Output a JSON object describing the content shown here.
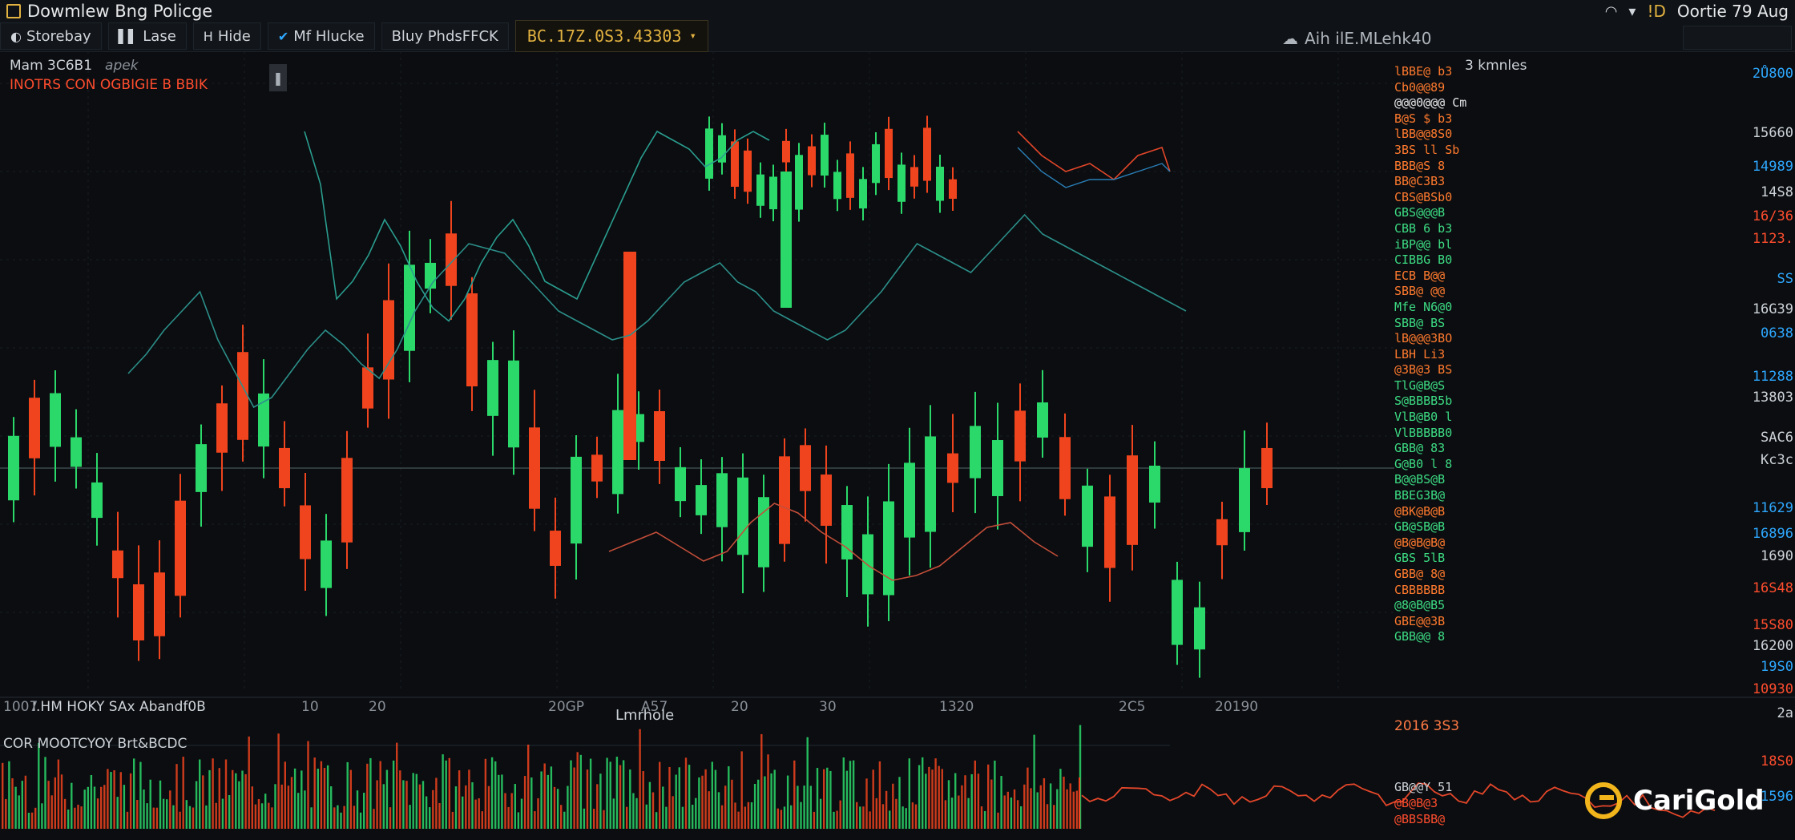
{
  "window": {
    "title": "Dowmlew Bng Policge",
    "clock": "Oortie 79 Aug",
    "clock_prefix": "!D"
  },
  "toolbar": {
    "buttons": [
      {
        "label": "Storebay",
        "icon": "compass-icon"
      },
      {
        "label": "Lase",
        "icon": "bar-icon"
      },
      {
        "label": "Hide",
        "icon": "h-icon"
      },
      {
        "label": "Mf Hlucke",
        "icon": "check-icon"
      },
      {
        "label": "Bluy PhdsFFCK",
        "icon": "none"
      }
    ],
    "price_field": "BC.17Z.0S3.43303",
    "center_label": "Aih ilE.MLehk40"
  },
  "legend": {
    "symbol": "Mam 3C6B1",
    "symbol2": "apek",
    "subtitle": "INOTRS CON OGBIGIE B BBIK"
  },
  "ladder": {
    "heading": "3 kmnles",
    "rows": [
      {
        "text": "lBBE@ b3",
        "color": "#ff7a2e"
      },
      {
        "text": "Cb0@@89",
        "color": "#ff7a2e"
      },
      {
        "text": "@@@0@@@ Cm",
        "color": "#e6e8ea"
      },
      {
        "text": "B@S $ b3",
        "color": "#ff7a2e"
      },
      {
        "text": "lBB@@8S0",
        "color": "#ff7a2e"
      },
      {
        "text": "3BS ll Sb",
        "color": "#ff7a2e"
      },
      {
        "text": "BBB@S 8",
        "color": "#ff7a2e"
      },
      {
        "text": "BB@C3B3",
        "color": "#ff7a2e"
      },
      {
        "text": "CBS@BSb0",
        "color": "#ff7a2e"
      },
      {
        "text": "GBS@@@B",
        "color": "#3ddc84"
      },
      {
        "text": "CBB 6 b3",
        "color": "#3ddc84"
      },
      {
        "text": "iBP@@ bl",
        "color": "#3ddc84"
      },
      {
        "text": "CIBBG B0",
        "color": "#3ddc84"
      },
      {
        "text": "ECB B@@",
        "color": "#ff7a2e"
      },
      {
        "text": "SBB@ @@",
        "color": "#ff7a2e"
      },
      {
        "text": "Mfe N6@0",
        "color": "#3ddc84"
      },
      {
        "text": "SBB@ BS",
        "color": "#3ddc84"
      },
      {
        "text": "lB@@@3BO",
        "color": "#ff7a2e"
      },
      {
        "text": "LBH Li3",
        "color": "#ff7a2e"
      },
      {
        "text": "@3B@3 BS",
        "color": "#ff7a2e"
      },
      {
        "text": "TlG@B@S",
        "color": "#3ddc84"
      },
      {
        "text": "S@BBBB5b",
        "color": "#3ddc84"
      },
      {
        "text": "VlB@B0 l",
        "color": "#3ddc84"
      },
      {
        "text": "VlBBBBB0",
        "color": "#3ddc84"
      },
      {
        "text": "GBB@ 83",
        "color": "#3ddc84"
      },
      {
        "text": "G@B0 l 8",
        "color": "#3ddc84"
      },
      {
        "text": "B@@BS@B",
        "color": "#3ddc84"
      },
      {
        "text": "BBEG3B@",
        "color": "#3ddc84"
      },
      {
        "text": "@BK@B@B",
        "color": "#ff7a2e"
      },
      {
        "text": "GB@SB@B",
        "color": "#3ddc84"
      },
      {
        "text": "@B@B@B@",
        "color": "#ff7a2e"
      },
      {
        "text": "GBS 5lB",
        "color": "#3ddc84"
      },
      {
        "text": "GBB@ 8@",
        "color": "#ff7a2e"
      },
      {
        "text": "CBBBBBB",
        "color": "#ff7a2e"
      },
      {
        "text": "@8@B@B5",
        "color": "#3ddc84"
      },
      {
        "text": "GBE@@3B",
        "color": "#ff7a2e"
      },
      {
        "text": "GBB@@ 8",
        "color": "#3ddc84"
      }
    ]
  },
  "right_axis": [
    {
      "text": "2Ů800",
      "color": "#2ea8ff",
      "y": 12
    },
    {
      "text": "15660",
      "color": "#cfd4da",
      "y": 86
    },
    {
      "text": "14989",
      "color": "#2ea8ff",
      "y": 128
    },
    {
      "text": "14S8",
      "color": "#cfd4da",
      "y": 160
    },
    {
      "text": "16/36",
      "color": "#ff4d2e",
      "y": 190
    },
    {
      "text": "1123.",
      "color": "#ff4d2e",
      "y": 218
    },
    {
      "text": "SS",
      "color": "#2ea8ff",
      "y": 268
    },
    {
      "text": "16G39",
      "color": "#cfd4da",
      "y": 306
    },
    {
      "text": "0638",
      "color": "#2ea8ff",
      "y": 336
    },
    {
      "text": "11288",
      "color": "#2ea8ff",
      "y": 390
    },
    {
      "text": "13803",
      "color": "#cfd4da",
      "y": 416
    },
    {
      "text": "SAC6",
      "color": "#cfd4da",
      "y": 466
    },
    {
      "text": "Kc3c",
      "color": "#cfd4da",
      "y": 494
    },
    {
      "text": "11629",
      "color": "#2ea8ff",
      "y": 554
    },
    {
      "text": "16896",
      "color": "#2ea8ff",
      "y": 586
    },
    {
      "text": "1690",
      "color": "#cfd4da",
      "y": 614
    },
    {
      "text": "16S48",
      "color": "#ff4d2e",
      "y": 654
    },
    {
      "text": "15S80",
      "color": "#ff4d2e",
      "y": 700
    },
    {
      "text": "16200",
      "color": "#cfd4da",
      "y": 726
    },
    {
      "text": "19S0",
      "color": "#2ea8ff",
      "y": 752
    },
    {
      "text": "10930",
      "color": "#ff4d2e",
      "y": 780
    },
    {
      "text": "2a",
      "color": "#cfd4da",
      "y": 810
    },
    {
      "text": "18S0",
      "color": "#ff4d2e",
      "y": 870
    },
    {
      "text": "1596",
      "color": "#2ea8ff",
      "y": 914
    }
  ],
  "x_axis": [
    {
      "text": "1007",
      "x": 4
    },
    {
      "text": "10",
      "x": 116
    },
    {
      "text": "20",
      "x": 200
    },
    {
      "text": "20GP",
      "x": 424
    },
    {
      "text": "A57",
      "x": 540
    },
    {
      "text": "20",
      "x": 652
    },
    {
      "text": "30",
      "x": 762
    },
    {
      "text": "1320",
      "x": 912
    },
    {
      "text": "2C5",
      "x": 1136
    },
    {
      "text": "20190",
      "x": 1256
    }
  ],
  "volume": {
    "label": "COR MOOTCYOY Brt&BCDC",
    "mid_label": "Lmrhole",
    "pane_title": "I.HM HOKY SAx Abandf0B"
  },
  "sub_pane": {
    "value": "2016 3S3",
    "ladder": [
      {
        "text": "GB@@Y 51",
        "color": "#cfd4da"
      },
      {
        "text": "@B@B@3",
        "color": "#ff4d2e"
      },
      {
        "text": "@BBSBB@",
        "color": "#ff4d2e"
      }
    ]
  },
  "brand": {
    "name": "CariGold",
    "accent": "#f2b51b"
  },
  "colors": {
    "up": "#2bd96b",
    "down": "#f0441e",
    "bg": "#0b0d10"
  },
  "chart_data": {
    "type": "line",
    "series": [
      {
        "values": [
          430,
          470,
          520,
          560,
          600,
          500,
          430,
          360,
          380,
          430,
          480,
          520,
          490,
          450,
          420,
          480,
          560,
          620,
          660,
          700,
          690,
          680,
          640,
          600,
          560,
          540,
          520,
          500,
          510,
          540,
          580,
          620,
          640,
          660,
          620,
          600,
          560,
          540,
          520,
          500,
          520,
          560,
          600,
          650,
          700,
          680,
          660,
          640,
          680,
          720,
          760,
          720,
          700,
          680,
          660,
          640,
          620,
          600,
          580,
          560
        ]
      },
      {
        "values": [
          900,
          780,
          520,
          560,
          620,
          700,
          640,
          560,
          500,
          470,
          520,
          600,
          660,
          700,
          640,
          560,
          540,
          520,
          600,
          680,
          760,
          840,
          900,
          880,
          860,
          820,
          840,
          880,
          900,
          880
        ]
      },
      {
        "values": [
          460,
          480,
          500,
          470,
          440,
          460,
          520,
          560,
          540,
          500,
          470,
          430,
          400,
          410,
          430,
          470,
          510,
          520,
          480,
          450
        ]
      }
    ]
  }
}
